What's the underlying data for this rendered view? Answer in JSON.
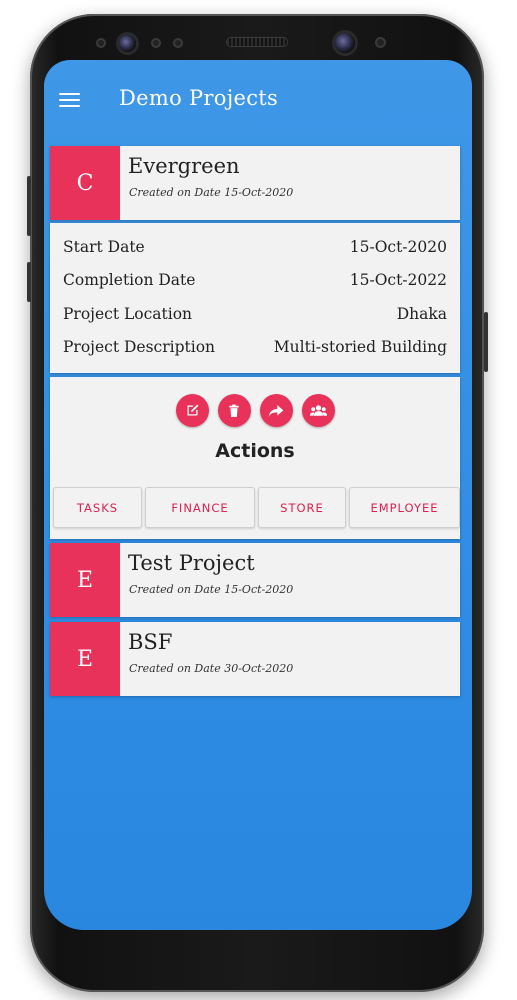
{
  "app": {
    "title": "Demo Projects"
  },
  "selected_project": {
    "letter": "C",
    "name": "Evergreen",
    "created": "Created on Date 15-Oct-2020",
    "details": [
      {
        "label": "Start Date",
        "value": "15-Oct-2020"
      },
      {
        "label": "Completion Date",
        "value": "15-Oct-2022"
      },
      {
        "label": "Project Location",
        "value": "Dhaka"
      },
      {
        "label": "Project Description",
        "value": "Multi-storied Building"
      }
    ]
  },
  "actions": {
    "title": "Actions",
    "icons": [
      "edit-icon",
      "delete-icon",
      "share-icon",
      "group-icon"
    ],
    "tabs": [
      "TASKS",
      "FINANCE",
      "STORE",
      "EMPLOYEE"
    ]
  },
  "projects": [
    {
      "letter": "E",
      "name": "Test Project",
      "created": "Created on Date 15-Oct-2020"
    },
    {
      "letter": "E",
      "name": "BSF",
      "created": "Created on Date 30-Oct-2020"
    }
  ],
  "colors": {
    "accent": "#e8325a",
    "background": "#2f8de4",
    "card": "#f2f2f2"
  }
}
